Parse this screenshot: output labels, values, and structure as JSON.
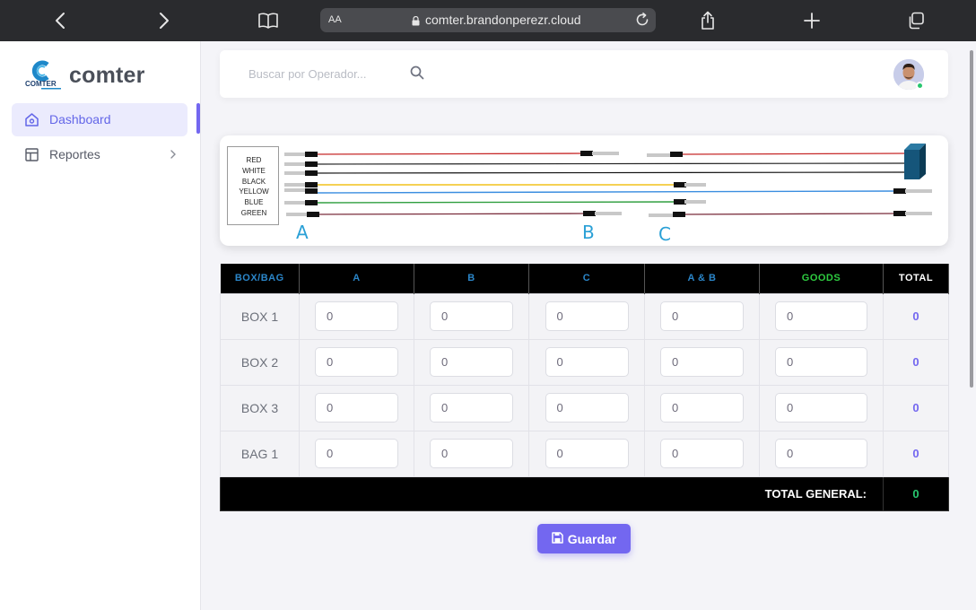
{
  "browser": {
    "aa_label": "AA",
    "url": "comter.brandonperezr.cloud",
    "icons": [
      "chevron-left-icon",
      "chevron-right-icon",
      "book-icon",
      "lock-icon",
      "reload-icon",
      "share-icon",
      "plus-icon",
      "tabs-icon"
    ]
  },
  "sidebar": {
    "brand": "comter",
    "logo_text": "COMTER",
    "items": [
      {
        "label": "Dashboard",
        "icon": "home-icon",
        "active": true
      },
      {
        "label": "Reportes",
        "icon": "layout-icon",
        "active": false
      }
    ]
  },
  "header": {
    "search_placeholder": "Buscar por Operador..."
  },
  "diagram": {
    "legend": [
      "RED",
      "WHITE",
      "BLACK",
      "YELLOW",
      "BLUE",
      "GREEN"
    ],
    "connectors": [
      "A",
      "B",
      "C"
    ]
  },
  "table": {
    "headers": [
      "BOX/BAG",
      "A",
      "B",
      "C",
      "A & B",
      "GOODS",
      "TOTAL"
    ],
    "rows": [
      {
        "label": "BOX 1",
        "a": "0",
        "b": "0",
        "c": "0",
        "ab": "0",
        "goods": "0",
        "total": "0"
      },
      {
        "label": "BOX 2",
        "a": "0",
        "b": "0",
        "c": "0",
        "ab": "0",
        "goods": "0",
        "total": "0"
      },
      {
        "label": "BOX 3",
        "a": "0",
        "b": "0",
        "c": "0",
        "ab": "0",
        "goods": "0",
        "total": "0"
      },
      {
        "label": "BAG 1",
        "a": "0",
        "b": "0",
        "c": "0",
        "ab": "0",
        "goods": "0",
        "total": "0"
      }
    ],
    "grand_total_label": "TOTAL GENERAL:",
    "grand_total_value": "0"
  },
  "actions": {
    "save_label": "Guardar"
  },
  "colors": {
    "accent": "#7367f0",
    "header_blue": "#2b86c9",
    "goods_green": "#2ecc40",
    "grand_total_green": "#28c76f"
  }
}
